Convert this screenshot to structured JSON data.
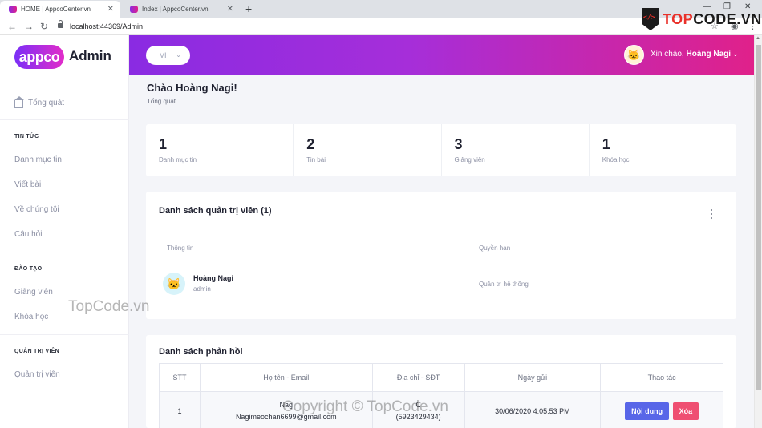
{
  "browser": {
    "tabs": [
      {
        "title": "HOME | AppcoCenter.vn",
        "active": true
      },
      {
        "title": "Index | AppcoCenter.vn",
        "active": false
      }
    ],
    "url": "localhost:44369/Admin"
  },
  "watermark_logo": {
    "prefix": "TOP",
    "suffix": "CODE.VN"
  },
  "brand": {
    "app": "appco",
    "admin": "Admin"
  },
  "sidebar": {
    "home": "Tổng quát",
    "sections": [
      {
        "title": "TIN TỨC",
        "items": [
          "Danh mục tin",
          "Viết bài",
          "Về chúng tôi",
          "Câu hỏi"
        ]
      },
      {
        "title": "ĐÀO TẠO",
        "items": [
          "Giảng viên",
          "Khóa học"
        ]
      },
      {
        "title": "QUẢN TRỊ VIÊN",
        "items": [
          "Quản trị viên"
        ]
      }
    ]
  },
  "topbar": {
    "lang": "VI",
    "greeting": "Xin chào,",
    "user_name": "Hoàng Nagi"
  },
  "page": {
    "title": "Chào Hoàng Nagi!",
    "breadcrumb": "Tổng quát"
  },
  "stats": [
    {
      "value": "1",
      "label": "Danh mục tin"
    },
    {
      "value": "2",
      "label": "Tin bài"
    },
    {
      "value": "3",
      "label": "Giảng viên"
    },
    {
      "value": "1",
      "label": "Khóa học"
    }
  ],
  "admins": {
    "title": "Danh sách quản trị viên (1)",
    "col_info": "Thông tin",
    "col_permission": "Quyền hạn",
    "rows": [
      {
        "name": "Hoàng Nagi",
        "role": "admin",
        "permission": "Quản trị hệ thống"
      }
    ]
  },
  "feedback": {
    "title": "Danh sách phản hồi",
    "headers": [
      "STT",
      "Họ tên - Email",
      "Địa chỉ - SĐT",
      "Ngày gửi",
      "Thao tác"
    ],
    "rows": [
      {
        "stt": "1",
        "name": "Nag",
        "email": "Nagimeochan6699@gmail.com",
        "address": "C",
        "phone": "(5923429434)",
        "date": "30/06/2020 4:05:53 PM",
        "view_label": "Nội dung",
        "delete_label": "Xóa"
      }
    ]
  },
  "watermarks": [
    "TopCode.vn",
    "Copyright © TopCode.vn"
  ],
  "colors": {
    "topbar_start": "#8a2be2",
    "topbar_end": "#e0218a",
    "btn_view": "#5866e8",
    "btn_delete": "#ef4f72"
  }
}
